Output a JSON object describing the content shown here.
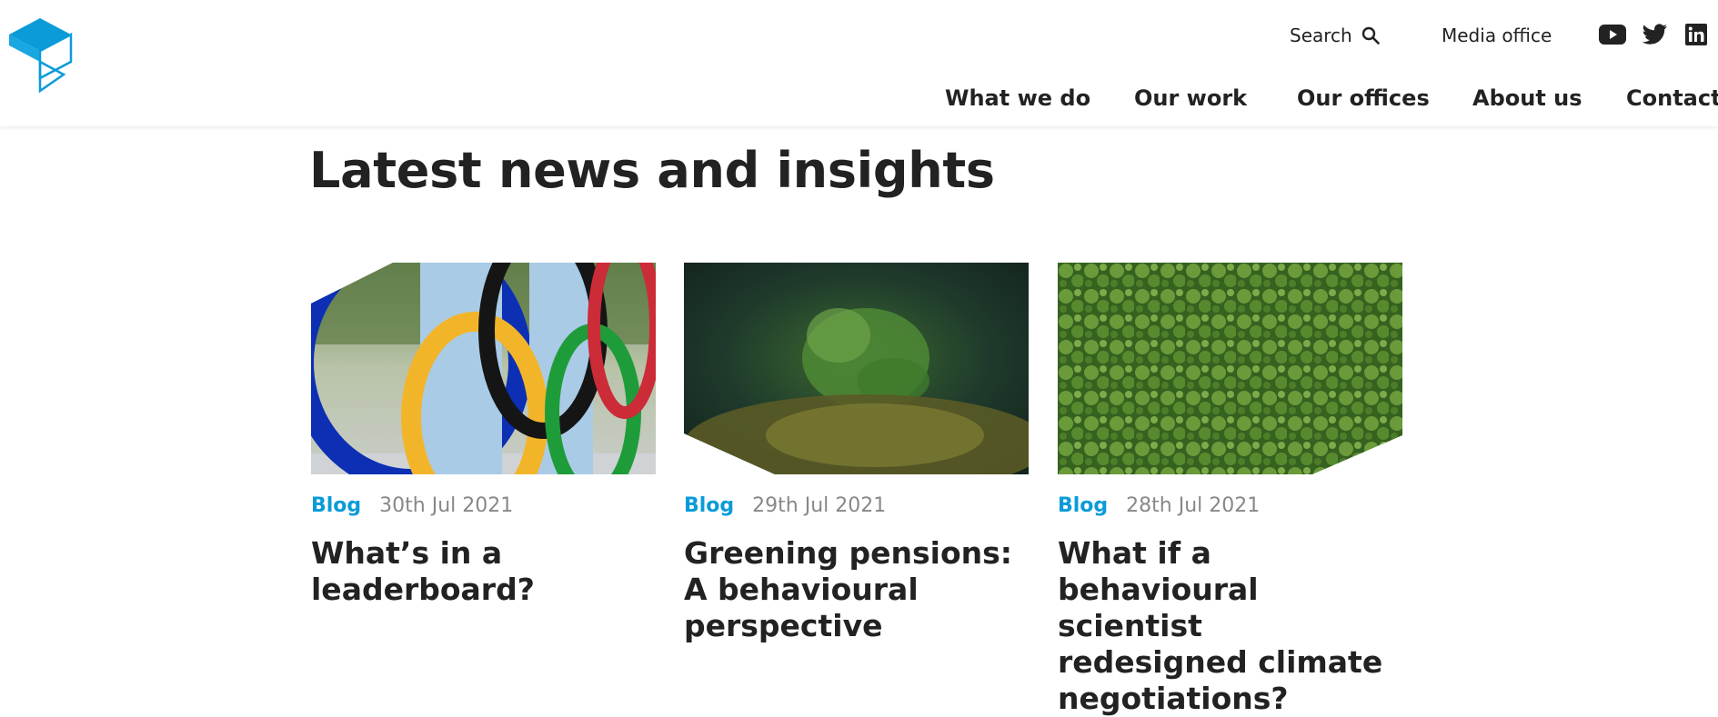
{
  "header": {
    "search_label": "Search",
    "media_label": "Media office",
    "social": [
      "youtube-icon",
      "twitter-icon",
      "linkedin-icon"
    ],
    "nav": [
      "What we do",
      "Our work",
      "Our offices",
      "About us",
      "Contact"
    ]
  },
  "main": {
    "title": "Latest news and insights",
    "cards": [
      {
        "type": "Blog",
        "date": "30th Jul 2021",
        "title": "What’s in a leaderboard?",
        "image": "olympic-rings-photo"
      },
      {
        "type": "Blog",
        "date": "29th Jul 2021",
        "title": "Greening pensions: A behavioural perspective",
        "image": "sapling-moss-photo"
      },
      {
        "type": "Blog",
        "date": "28th Jul 2021",
        "title": "What if a behavioural scientist redesigned climate negotiations?",
        "image": "forest-aerial-photo"
      }
    ]
  },
  "colors": {
    "accent": "#0a9bd8",
    "text": "#222222",
    "muted": "#888888"
  }
}
